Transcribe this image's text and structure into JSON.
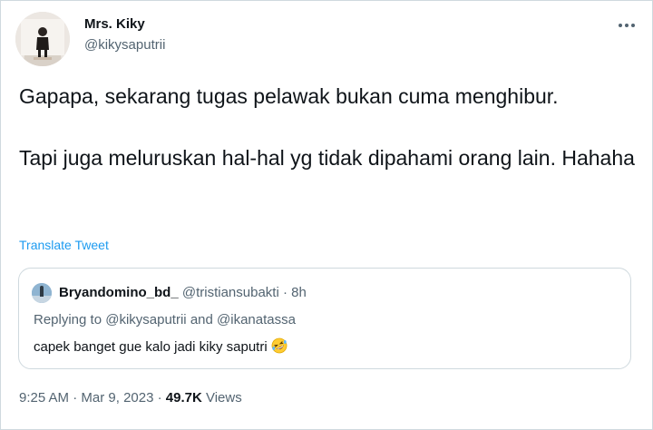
{
  "author": {
    "name": "Mrs. Kiky",
    "handle": "@kikysaputrii"
  },
  "tweet": {
    "paragraph1": "Gapapa, sekarang tugas pelawak bukan cuma menghibur.",
    "paragraph2": "Tapi juga meluruskan hal-hal yg tidak dipahami orang lain. Hahaha",
    "translate_label": "Translate Tweet"
  },
  "quoted": {
    "name": "Bryandomino_bd_",
    "handle": "@tristiansubakti",
    "separator": "·",
    "time": "8h",
    "replying_prefix": "Replying to",
    "replying_to_1": "@kikysaputrii",
    "replying_and": "and",
    "replying_to_2": "@ikanatassa",
    "text": "capek banget gue kalo jadi kiky saputri"
  },
  "meta": {
    "time": "9:25 AM",
    "date": "Mar 9, 2023",
    "separator": "·",
    "views_count": "49.7K",
    "views_label": "Views"
  },
  "icons": {
    "more": "more-icon",
    "emoji": "rolling-on-floor-laughing-emoji"
  },
  "colors": {
    "link": "#1d9bf0",
    "secondary_text": "#536471",
    "primary_text": "#0f1419",
    "border": "#cfd9de"
  }
}
